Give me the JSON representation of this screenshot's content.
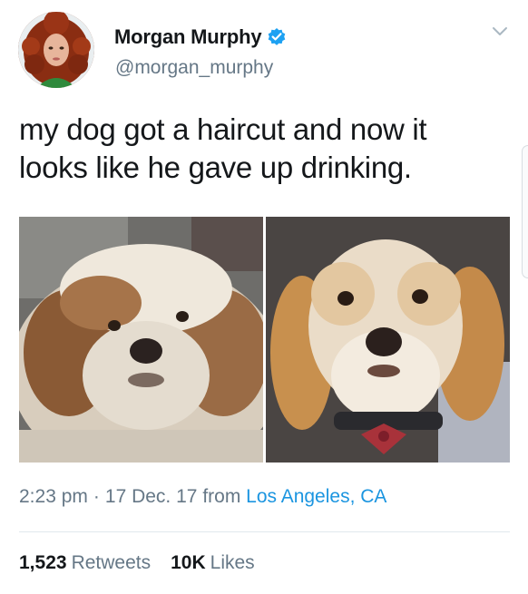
{
  "user": {
    "display_name": "Morgan Murphy",
    "handle": "@morgan_murphy",
    "verified": true,
    "verified_icon": "verified-badge-icon",
    "verified_color": "#1da1f2"
  },
  "tweet": {
    "text": "my dog got a haircut and now it looks like he gave up drinking.",
    "time": "2:23 pm",
    "separator": "·",
    "date": "17 Dec. 17",
    "from_label": "from",
    "location": "Los Angeles, CA"
  },
  "stats": {
    "retweets_count": "1,523",
    "retweets_label": "Retweets",
    "likes_count": "10K",
    "likes_label": "Likes"
  },
  "menu_icon": "chevron-down-icon",
  "colors": {
    "text": "#14171a",
    "secondary": "#657786",
    "link": "#1b95e0",
    "divider": "#e1e8ed"
  }
}
